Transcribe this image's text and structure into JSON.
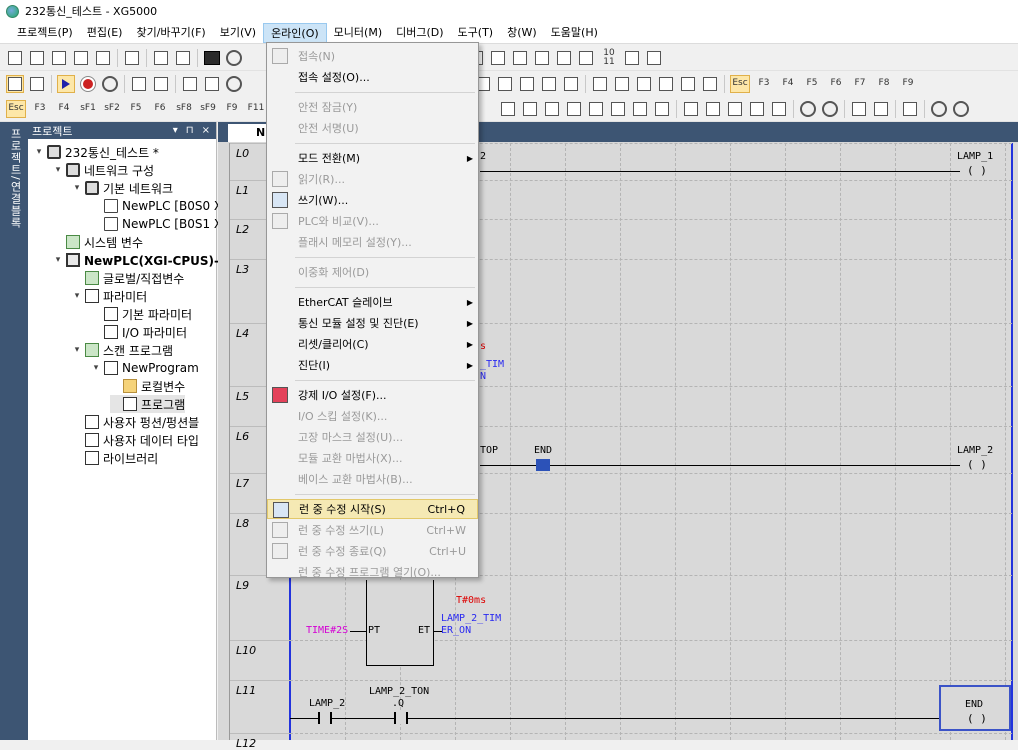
{
  "window": {
    "title": "232통신_테스트 - XG5000"
  },
  "menubar": {
    "items": [
      "프로젝트(P)",
      "편집(E)",
      "찾기/바꾸기(F)",
      "보기(V)",
      "온라인(O)",
      "모니터(M)",
      "디버그(D)",
      "도구(T)",
      "창(W)",
      "도움말(H)"
    ]
  },
  "toolbar2": {
    "labels": [
      "Esc",
      "F3",
      "F4",
      "F5",
      "F6",
      "F7",
      "F8",
      "F9"
    ]
  },
  "toolbar3": {
    "labels": [
      "Esc",
      "F3",
      "F4",
      "sF1",
      "sF2",
      "F5",
      "F6",
      "sF8",
      "sF9",
      "F9",
      "F11",
      "F10"
    ]
  },
  "toolbar1": {
    "small_label": "10\n11"
  },
  "lefttab": {
    "label": "프로젝트/연결블록"
  },
  "project": {
    "header": "프로젝트",
    "header_buttons": [
      "▾",
      "⊓",
      "×"
    ],
    "tree": [
      {
        "label": "232통신_테스트 *",
        "indent": 0,
        "expand": "▾",
        "icon": "net",
        "bold": false
      },
      {
        "label": "네트워크 구성",
        "indent": 1,
        "expand": "▾",
        "icon": "net",
        "bold": false
      },
      {
        "label": "기본 네트워크",
        "indent": 2,
        "expand": "▾",
        "icon": "net",
        "bold": false
      },
      {
        "label": "NewPLC [B0S0 X",
        "indent": 3,
        "expand": "",
        "icon": "plc",
        "bold": false
      },
      {
        "label": "NewPLC [B0S1 X",
        "indent": 3,
        "expand": "",
        "icon": "plc",
        "bold": false
      },
      {
        "label": "시스템 변수",
        "indent": 1,
        "expand": "",
        "icon": "var",
        "bold": false
      },
      {
        "label": "NewPLC(XGI-CPUS)-런",
        "indent": 1,
        "expand": "▾",
        "icon": "cpu",
        "bold": true
      },
      {
        "label": "글로벌/직접변수",
        "indent": 2,
        "expand": "",
        "icon": "var",
        "bold": false
      },
      {
        "label": "파라미터",
        "indent": 2,
        "expand": "▾",
        "icon": "prog",
        "bold": false
      },
      {
        "label": "기본 파라미터",
        "indent": 3,
        "expand": "",
        "icon": "prog",
        "bold": false
      },
      {
        "label": "I/O 파라미터",
        "indent": 3,
        "expand": "",
        "icon": "prog",
        "bold": false
      },
      {
        "label": "스캔 프로그램",
        "indent": 2,
        "expand": "▾",
        "icon": "var",
        "bold": false
      },
      {
        "label": "NewProgram",
        "indent": 3,
        "expand": "▾",
        "icon": "prog",
        "bold": false
      },
      {
        "label": "로컬변수",
        "indent": 4,
        "expand": "",
        "icon": "folder",
        "bold": false
      },
      {
        "label": "프로그램",
        "indent": 4,
        "expand": "",
        "icon": "prog",
        "bold": false,
        "selected": true
      },
      {
        "label": "사용자 펑션/펑션블",
        "indent": 2,
        "expand": "",
        "icon": "prog",
        "bold": false
      },
      {
        "label": "사용자 데이터 타입",
        "indent": 2,
        "expand": "",
        "icon": "prog",
        "bold": false
      },
      {
        "label": "라이브러리",
        "indent": 2,
        "expand": "",
        "icon": "prog",
        "bold": false
      }
    ]
  },
  "editor": {
    "tab_label": "N",
    "rows": [
      "L0",
      "L1",
      "L2",
      "L3",
      "L4",
      "L5",
      "L6",
      "L7",
      "L8",
      "L9",
      "L10",
      "L11",
      "L12"
    ],
    "partial_labels": {
      "l0": "2",
      "l4_red": "s",
      "l4_blue1": "_TIM",
      "l4_blue2": "N",
      "l6_stop": "TOP"
    },
    "coils": [
      {
        "label": "LAMP_1"
      },
      {
        "label": "LAMP_2"
      }
    ],
    "contact_end_label": "END",
    "block": {
      "preset": "TIME#2S",
      "pt": "PT",
      "et": "ET",
      "elapsed": "T#0ms",
      "out_name_1": "LAMP_2_TIM",
      "out_name_2": "ER_ON"
    },
    "row11": {
      "contact1": "LAMP_2",
      "contact2a": "LAMP_2_TON",
      "contact2b": ".Q",
      "end_label": "END"
    },
    "coil_symbol": "( )"
  },
  "dropdown": {
    "items": [
      {
        "label": "접속(N)",
        "shortcut": "",
        "disabled": true,
        "icon": "connect-icon",
        "submenu": false
      },
      {
        "label": "접속 설정(O)...",
        "shortcut": "",
        "disabled": false,
        "icon": "",
        "submenu": false
      },
      {
        "sep": true
      },
      {
        "label": "안전 잠금(Y)",
        "shortcut": "",
        "disabled": true,
        "icon": "",
        "submenu": false
      },
      {
        "label": "안전 서명(U)",
        "shortcut": "",
        "disabled": true,
        "icon": "",
        "submenu": false
      },
      {
        "sep": true
      },
      {
        "label": "모드 전환(M)",
        "shortcut": "",
        "disabled": false,
        "icon": "",
        "submenu": true
      },
      {
        "label": "읽기(R)...",
        "shortcut": "",
        "disabled": true,
        "icon": "read-icon",
        "submenu": false
      },
      {
        "label": "쓰기(W)...",
        "shortcut": "",
        "disabled": false,
        "icon": "write-icon",
        "submenu": false
      },
      {
        "label": "PLC와 비교(V)...",
        "shortcut": "",
        "disabled": true,
        "icon": "compare-icon",
        "submenu": false
      },
      {
        "label": "플래시 메모리 설정(Y)...",
        "shortcut": "",
        "disabled": true,
        "icon": "",
        "submenu": false
      },
      {
        "sep": true
      },
      {
        "label": "이중화 제어(D)",
        "shortcut": "",
        "disabled": true,
        "icon": "",
        "submenu": false
      },
      {
        "sep": true
      },
      {
        "label": "EtherCAT 슬레이브",
        "shortcut": "",
        "disabled": false,
        "icon": "",
        "submenu": true
      },
      {
        "label": "통신 모듈 설정 및 진단(E)",
        "shortcut": "",
        "disabled": false,
        "icon": "",
        "submenu": true
      },
      {
        "label": "리셋/클리어(C)",
        "shortcut": "",
        "disabled": false,
        "icon": "",
        "submenu": true
      },
      {
        "label": "진단(I)",
        "shortcut": "",
        "disabled": false,
        "icon": "",
        "submenu": true
      },
      {
        "sep": true
      },
      {
        "label": "강제 I/O 설정(F)...",
        "shortcut": "",
        "disabled": false,
        "icon": "force-io-icon",
        "submenu": false
      },
      {
        "label": "I/O 스킵 설정(K)...",
        "shortcut": "",
        "disabled": true,
        "icon": "",
        "submenu": false
      },
      {
        "label": "고장 마스크 설정(U)...",
        "shortcut": "",
        "disabled": true,
        "icon": "",
        "submenu": false
      },
      {
        "label": "모듈 교환 마법사(X)...",
        "shortcut": "",
        "disabled": true,
        "icon": "",
        "submenu": false
      },
      {
        "label": "베이스 교환 마법사(B)...",
        "shortcut": "",
        "disabled": true,
        "icon": "",
        "submenu": false
      },
      {
        "sep": true
      },
      {
        "label": "런 중 수정 시작(S)",
        "shortcut": "Ctrl+Q",
        "disabled": false,
        "icon": "edit-run-icon",
        "submenu": false,
        "hover": true
      },
      {
        "label": "런 중 수정 쓰기(L)",
        "shortcut": "Ctrl+W",
        "disabled": true,
        "icon": "write-run-icon",
        "submenu": false
      },
      {
        "label": "런 중 수정 종료(Q)",
        "shortcut": "Ctrl+U",
        "disabled": true,
        "icon": "end-run-icon",
        "submenu": false
      },
      {
        "label": "런 중 수정 프로그램 열기(O)...",
        "shortcut": "",
        "disabled": true,
        "icon": "",
        "submenu": false
      }
    ]
  },
  "colors": {
    "accent": "#3d5573",
    "rail": "#2233dd",
    "highlight": "#f5e9b4"
  }
}
